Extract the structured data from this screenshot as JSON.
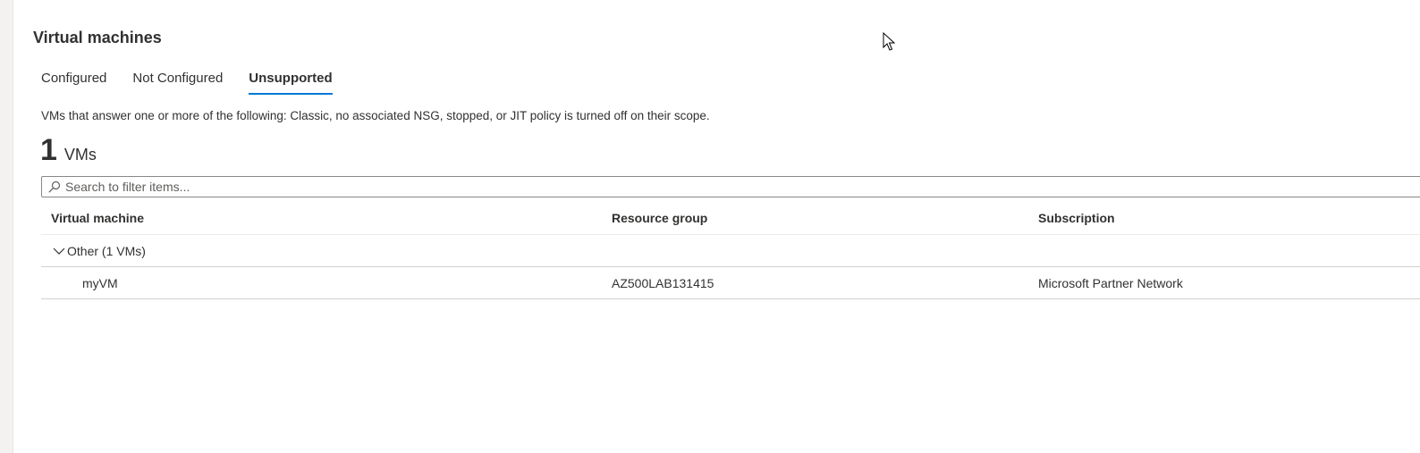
{
  "section": {
    "title": "Virtual machines"
  },
  "tabs": [
    {
      "label": "Configured",
      "active": false
    },
    {
      "label": "Not Configured",
      "active": false
    },
    {
      "label": "Unsupported",
      "active": true
    }
  ],
  "description": "VMs that answer one or more of the following: Classic, no associated NSG, stopped, or JIT policy is turned off on their scope.",
  "count": {
    "number": "1",
    "unit": "VMs"
  },
  "search": {
    "placeholder": "Search to filter items...",
    "value": ""
  },
  "table": {
    "columns": [
      "Virtual machine",
      "Resource group",
      "Subscription"
    ],
    "group": {
      "label": "Other (1 VMs)",
      "expanded": true
    },
    "rows": [
      {
        "vm": "myVM",
        "resource_group": "AZ500LAB131415",
        "subscription": "Microsoft Partner Network"
      }
    ]
  },
  "colors": {
    "accent": "#0078d4",
    "text": "#323130",
    "border": "#d2d0ce"
  },
  "icons": {
    "search": "search-icon",
    "chevron": "chevron-down-icon",
    "cursor": "mouse-cursor-icon"
  }
}
